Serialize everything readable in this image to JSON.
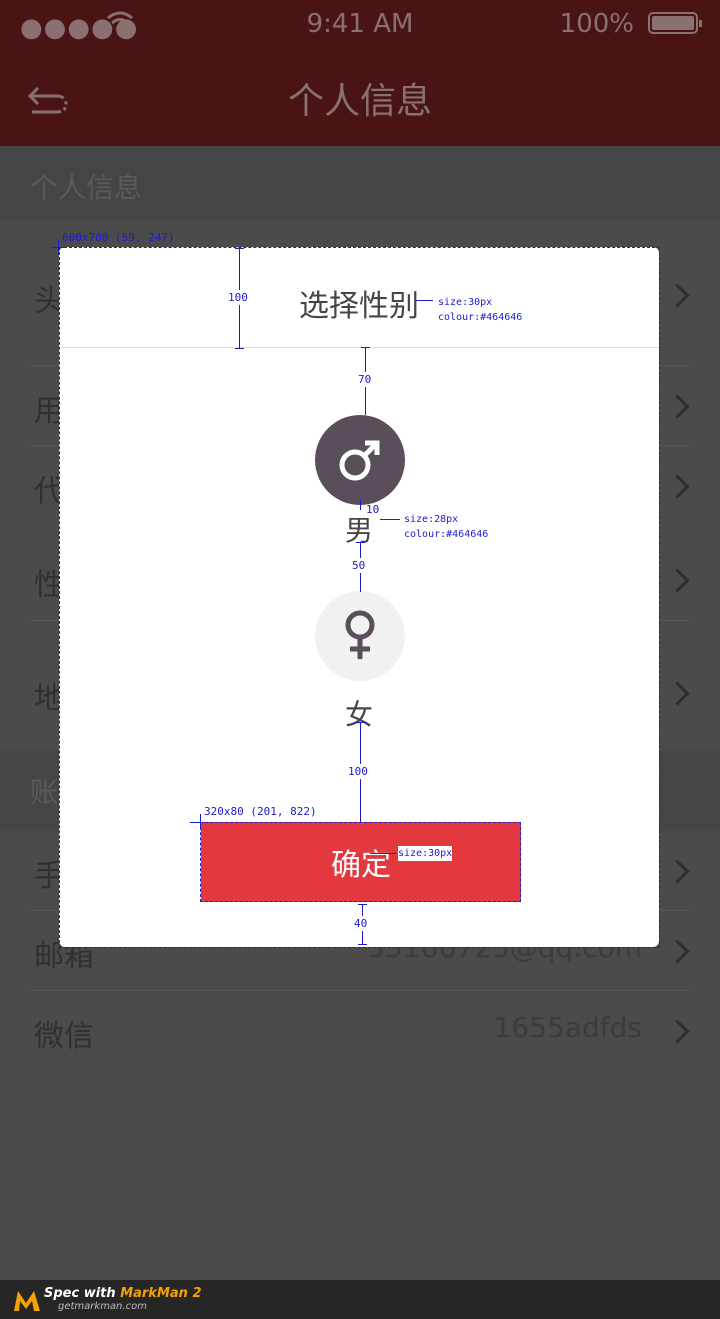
{
  "status_bar": {
    "signal": "●●●●●",
    "time": "9:41 AM",
    "battery_pct": "100%"
  },
  "nav": {
    "title": "个人信息",
    "back_icon": "back-arrow-icon"
  },
  "background": {
    "sections": [
      {
        "header": "个人信息"
      },
      {
        "header": "账"
      }
    ],
    "rows": [
      {
        "label": "头",
        "value": ""
      },
      {
        "label": "用",
        "value": ""
      },
      {
        "label": "代",
        "value": ""
      },
      {
        "label": "性",
        "value": ""
      },
      {
        "label": "地",
        "value": ""
      },
      {
        "label": "手",
        "value": ""
      },
      {
        "label": "邮箱",
        "value": "55166725@qq.com"
      },
      {
        "label": "微信",
        "value": "1655adfds"
      }
    ]
  },
  "dialog": {
    "title": "选择性别",
    "options": [
      {
        "label": "男",
        "symbol": "♂",
        "icon": "male-icon",
        "selected": true
      },
      {
        "label": "女",
        "symbol": "♀",
        "icon": "female-icon",
        "selected": false
      }
    ],
    "confirm_label": "确定"
  },
  "colors": {
    "accent_red": "#e3383e",
    "nav_bg_dimmed": "#4a1414",
    "text_dark": "#464646",
    "selected_circle": "#5a4e5a",
    "unselected_circle": "#f1f1f1",
    "spec_blue": "#1b1bd0"
  },
  "spec_annotations": {
    "dialog_box": "600x700 (59, 247)",
    "title_height": "100",
    "title_spec": "size:30px\ncolour:#464646",
    "gap_title_icon": "70",
    "gap_icon_label": "10",
    "label_spec": "size:28px\ncolour:#464646",
    "gap_label_icon": "50",
    "gap_label_button": "100",
    "button_box": "320x80 (201, 822)",
    "button_spec": "size:30px",
    "gap_button_bottom": "40"
  },
  "footer": {
    "brand_prefix": "Spec with ",
    "brand_name": "MarkMan 2",
    "url": "getmarkman.com"
  }
}
